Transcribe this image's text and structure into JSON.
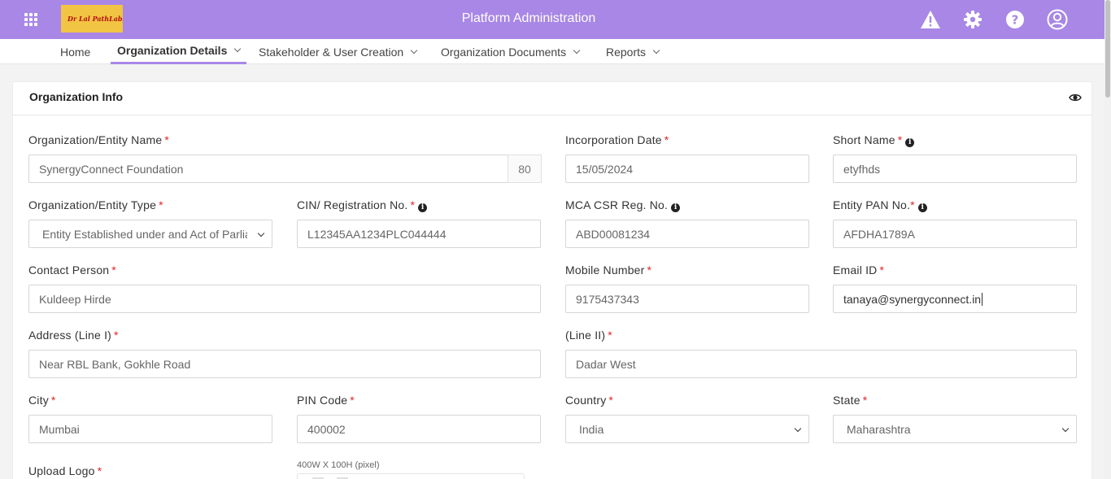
{
  "header": {
    "title": "Platform Administration",
    "logo_text": "Dr Lal PathLabs",
    "icons": [
      "grid-menu-icon",
      "alert-icon",
      "settings-icon",
      "help-icon",
      "user-profile-icon"
    ]
  },
  "nav": {
    "items": [
      {
        "label": "Home",
        "dropdown": false
      },
      {
        "label": "Organization Details",
        "dropdown": true,
        "active": true
      },
      {
        "label": "Stakeholder & User Creation",
        "dropdown": true
      },
      {
        "label": "Organization Documents",
        "dropdown": true
      },
      {
        "label": "Reports",
        "dropdown": true
      }
    ]
  },
  "card": {
    "title": "Organization Info",
    "toggle_icon": "eye-icon"
  },
  "form": {
    "org_name": {
      "label": "Organization/Entity Name",
      "value": "SynergyConnect Foundation",
      "counter": "80"
    },
    "incorporation_date": {
      "label": "Incorporation Date",
      "value": "15/05/2024"
    },
    "short_name": {
      "label": "Short Name",
      "value": "etyfhds"
    },
    "org_type": {
      "label": "Organization/Entity Type",
      "value": "Entity Established under and Act of Parliament"
    },
    "cin": {
      "label": "CIN/ Registration No.",
      "value": "L12345AA1234PLC044444"
    },
    "mca_csr": {
      "label": "MCA CSR Reg. No.",
      "value": "ABD00081234"
    },
    "pan": {
      "label": "Entity PAN No.",
      "value": "AFDHA1789A"
    },
    "contact_person": {
      "label": "Contact Person",
      "value": "Kuldeep Hirde"
    },
    "mobile": {
      "label": "Mobile Number",
      "value": "9175437343"
    },
    "email": {
      "label": "Email ID",
      "value": "tanaya@synergyconnect.in"
    },
    "address1": {
      "label": "Address (Line I)",
      "value": "Near RBL Bank, Gokhle Road"
    },
    "address2": {
      "label": "(Line II)",
      "value": "Dadar West"
    },
    "city": {
      "label": "City",
      "value": "Mumbai"
    },
    "pin": {
      "label": "PIN Code",
      "value": "400002"
    },
    "country": {
      "label": "Country",
      "value": "India"
    },
    "state": {
      "label": "State",
      "value": "Maharashtra"
    },
    "logo": {
      "label": "Upload Logo",
      "hint": "400W X 100H (pixel)"
    }
  },
  "colors": {
    "header_bg": "#a887e6",
    "required": "#e02525",
    "logo_bg": "#f2c443"
  }
}
